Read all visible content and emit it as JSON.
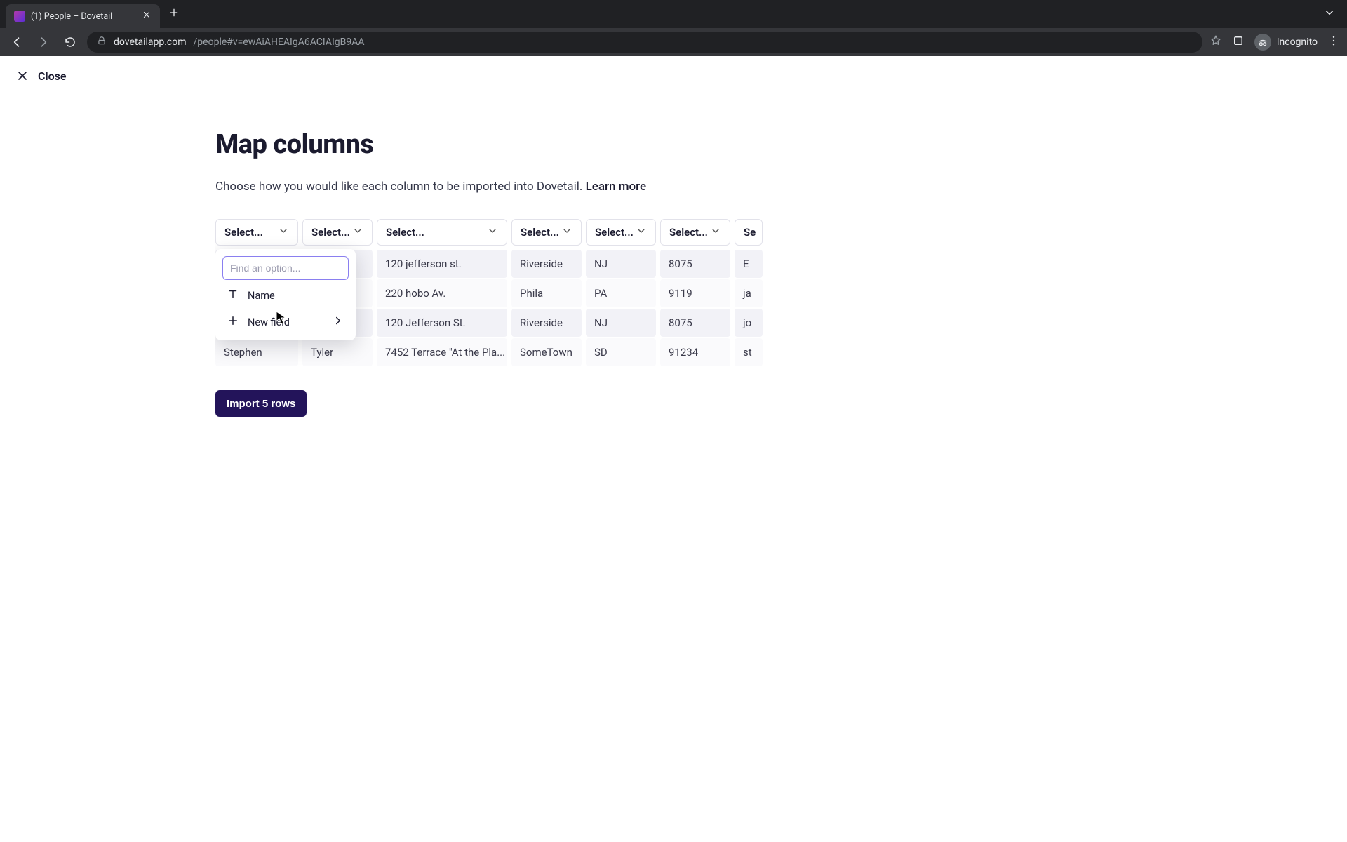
{
  "browser": {
    "tab_title": "(1) People – Dovetail",
    "incognito_label": "Incognito",
    "url_host": "dovetailapp.com",
    "url_path": "/people#v=ewAiAHEAIgA6ACIAIgB9AA"
  },
  "header": {
    "close_label": "Close"
  },
  "page": {
    "title": "Map columns",
    "subtitle_text": "Choose how you would like each column to be imported into Dovetail. ",
    "subtitle_link": "Learn more"
  },
  "columns": {
    "placeholder": "Select...",
    "headers": [
      "Select...",
      "Select...",
      "Select...",
      "Select...",
      "Select...",
      "Select...",
      "Se"
    ]
  },
  "dropdown": {
    "search_placeholder": "Find an option...",
    "option_name": "Name",
    "option_new_field": "New field"
  },
  "rows": [
    {
      "c0": "",
      "c1": "",
      "c2": "120 jefferson st.",
      "c3": "Riverside",
      "c4": "NJ",
      "c5": "8075",
      "c6": "E"
    },
    {
      "c0": "",
      "c1": "",
      "c2": "220 hobo Av.",
      "c3": "Phila",
      "c4": "PA",
      "c5": "9119",
      "c6": "ja"
    },
    {
      "c0": "",
      "c1": "",
      "c2": "120 Jefferson St.",
      "c3": "Riverside",
      "c4": "NJ",
      "c5": "8075",
      "c6": "jo"
    },
    {
      "c0": "Stephen",
      "c1": "Tyler",
      "c2": "7452 Terrace \"At the Pla...",
      "c3": "SomeTown",
      "c4": "SD",
      "c5": "91234",
      "c6": "st"
    }
  ],
  "import_button": "Import 5 rows",
  "colors": {
    "accent": "#23145a",
    "focus_ring": "#8a7ff0"
  }
}
